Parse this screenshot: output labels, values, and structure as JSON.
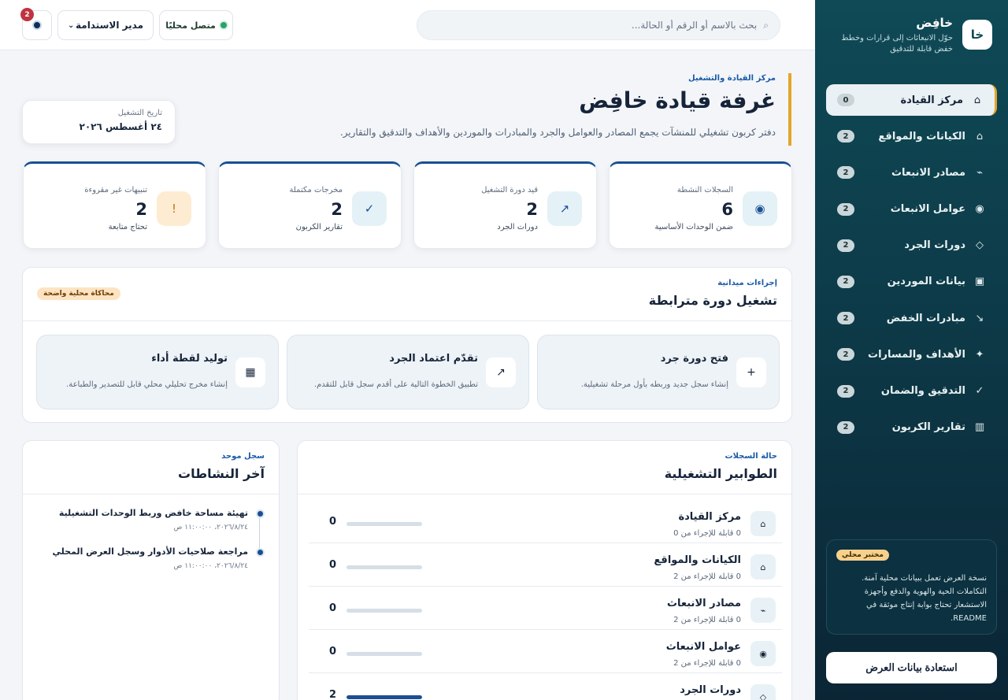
{
  "sidebar": {
    "brand_logo": "خا",
    "brand_name": "خافِض",
    "brand_tagline": "حوّل الانبعاثات إلى قرارات وخطط خفض قابلة للتدقيق",
    "items": [
      {
        "label": "مركز القيادة",
        "count": "0",
        "icon": "⌂",
        "icon_name": "home-icon",
        "active": true
      },
      {
        "label": "الكيانات والمواقع",
        "count": "2",
        "icon": "⌂",
        "icon_name": "building-icon"
      },
      {
        "label": "مصادر الانبعاث",
        "count": "2",
        "icon": "⌁",
        "icon_name": "source-icon"
      },
      {
        "label": "عوامل الانبعاث",
        "count": "2",
        "icon": "◉",
        "icon_name": "factor-icon"
      },
      {
        "label": "دورات الجرد",
        "count": "2",
        "icon": "◇",
        "icon_name": "cycle-icon"
      },
      {
        "label": "بيانات الموردين",
        "count": "2",
        "icon": "▣",
        "icon_name": "supplier-icon"
      },
      {
        "label": "مبادرات الخفض",
        "count": "2",
        "icon": "↘",
        "icon_name": "reduction-icon"
      },
      {
        "label": "الأهداف والمسارات",
        "count": "2",
        "icon": "✦",
        "icon_name": "target-icon"
      },
      {
        "label": "التدقيق والضمان",
        "count": "2",
        "icon": "✓",
        "icon_name": "check-icon"
      },
      {
        "label": "تقارير الكربون",
        "count": "2",
        "icon": "▥",
        "icon_name": "report-icon"
      }
    ],
    "lab_badge": "مختبر محلي",
    "lab_text": "نسخة العرض تعمل ببيانات محلية آمنة. التكاملات الحية والهوية والدفع وأجهزة الاستشعار تحتاج بوابة إنتاج موثقة في README.",
    "restore_label": "استعادة بيانات العرض"
  },
  "topbar": {
    "search_placeholder": "بحث بالاسم أو الرقم أو الحالة...",
    "status_label": "متصل محليًا",
    "role_label": "مدير الاستدامة",
    "notifications_count": "2"
  },
  "hero": {
    "eyebrow": "مركز القيادة والتشغيل",
    "title": "غرفة قيادة خافِض",
    "description": "دفتر كربون تشغيلي للمنشآت يجمع المصادر والعوامل والجرد والمبادرات والموردين والأهداف والتدقيق والتقارير.",
    "date_label": "تاريخ التشغيل",
    "date_value": "٢٤ أغسطس ٢٠٢٦"
  },
  "stats": [
    {
      "label": "السجلات النشطة",
      "value": "6",
      "sub": "ضمن الوحدات الأساسية",
      "icon": "◉",
      "icon_name": "records-icon",
      "bg": "#e4f1f7",
      "fg": "#1a4f93"
    },
    {
      "label": "قيد دورة التشغيل",
      "value": "2",
      "sub": "دورات الجرد",
      "icon": "↗",
      "icon_name": "arrow-up-right-icon",
      "bg": "#e4f1f7",
      "fg": "#1a4f93"
    },
    {
      "label": "مخرجات مكتملة",
      "value": "2",
      "sub": "تقارير الكربون",
      "icon": "✓",
      "icon_name": "check-icon",
      "bg": "#e4f1f7",
      "fg": "#1a4f93"
    },
    {
      "label": "تنبيهات غير مقروءة",
      "value": "2",
      "sub": "تحتاج متابعة",
      "icon": "!",
      "icon_name": "alert-icon",
      "bg": "#fdecd2",
      "fg": "#b7791f"
    }
  ],
  "actions": {
    "eyebrow": "إجراءات ميدانية",
    "title": "تشغيل دورة مترابطة",
    "badge": "محاكاة محلية واضحة",
    "items": [
      {
        "title": "فتح دورة جرد",
        "desc": "إنشاء سجل جديد وربطه بأول مرحلة تشغيلية.",
        "icon": "+",
        "icon_name": "plus-icon"
      },
      {
        "title": "تقدّم اعتماد الجرد",
        "desc": "تطبيق الخطوة التالية على أقدم سجل قابل للتقدم.",
        "icon": "↗",
        "icon_name": "arrow-up-right-icon"
      },
      {
        "title": "توليد لقطة أداء",
        "desc": "إنشاء مخرج تحليلي محلي قابل للتصدير والطباعة.",
        "icon": "▦",
        "icon_name": "snapshot-icon"
      }
    ]
  },
  "queues": {
    "eyebrow": "حالة السجلات",
    "title": "الطوابير التشغيلية",
    "rows": [
      {
        "name": "مركز القيادة",
        "sub": "0 قابلة للإجراء من 0",
        "count": "0",
        "progress": 0,
        "icon": "⌂",
        "icon_name": "home-icon"
      },
      {
        "name": "الكيانات والمواقع",
        "sub": "0 قابلة للإجراء من 2",
        "count": "0",
        "progress": 0,
        "icon": "⌂",
        "icon_name": "building-icon"
      },
      {
        "name": "مصادر الانبعاث",
        "sub": "0 قابلة للإجراء من 2",
        "count": "0",
        "progress": 0,
        "icon": "⌁",
        "icon_name": "source-icon"
      },
      {
        "name": "عوامل الانبعاث",
        "sub": "0 قابلة للإجراء من 2",
        "count": "0",
        "progress": 0,
        "icon": "◉",
        "icon_name": "factor-icon"
      },
      {
        "name": "دورات الجرد",
        "sub": "",
        "count": "2",
        "progress": 1,
        "icon": "◇",
        "icon_name": "cycle-icon"
      }
    ]
  },
  "activity": {
    "eyebrow": "سجل موحد",
    "title": "آخر النشاطات",
    "items": [
      {
        "title": "تهيئة مساحة خافض وربط الوحدات التشغيلية",
        "time": "٢٠٢٦/٨/٢٤، ١١:٠٠:٠٠ ص"
      },
      {
        "title": "مراجعة صلاحيات الأدوار وسجل العرض المحلي",
        "time": "٢٠٢٦/٨/٢٤، ١١:٠٠:٠٠ ص"
      }
    ]
  }
}
